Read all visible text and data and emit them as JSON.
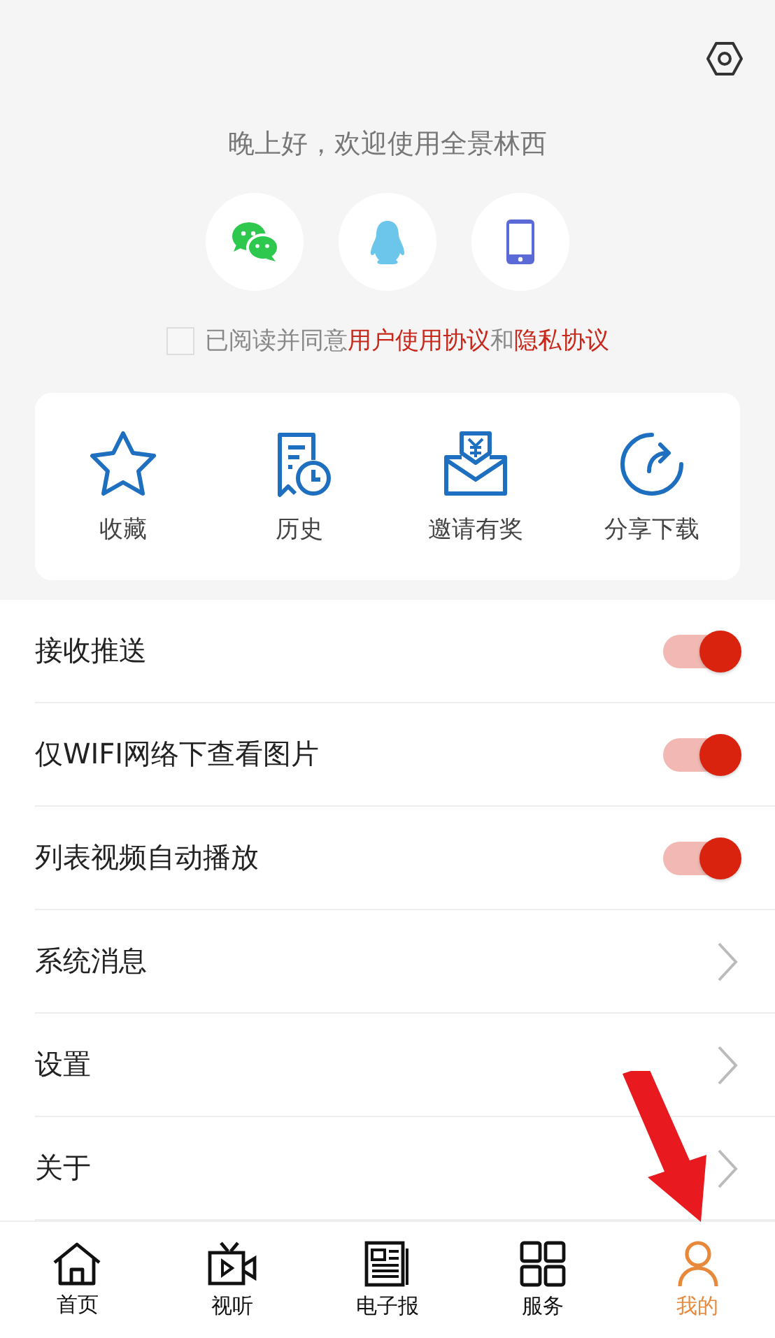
{
  "greeting": "晚上好，欢迎使用全景林西",
  "agreement": {
    "checked": false,
    "parts": [
      {
        "kind": "text",
        "text": "已阅读并同意"
      },
      {
        "kind": "link",
        "text": "用户使用协议"
      },
      {
        "kind": "text",
        "text": "和"
      },
      {
        "kind": "link",
        "text": "隐私协议"
      }
    ]
  },
  "quick_actions": [
    "收藏",
    "历史",
    "邀请有奖",
    "分享下载"
  ],
  "settings": [
    {
      "kind": "toggle",
      "label": "接收推送",
      "on": true
    },
    {
      "kind": "toggle",
      "label": "仅WIFI网络下查看图片",
      "on": true
    },
    {
      "kind": "toggle",
      "label": "列表视频自动播放",
      "on": true
    },
    {
      "kind": "link",
      "label": "系统消息"
    },
    {
      "kind": "link",
      "label": "设置"
    },
    {
      "kind": "link",
      "label": "关于"
    }
  ],
  "tabs": [
    {
      "label": "首页",
      "selected": false
    },
    {
      "label": "视听",
      "selected": false
    },
    {
      "label": "电子报",
      "selected": false
    },
    {
      "label": "服务",
      "selected": false
    },
    {
      "label": "我的",
      "selected": true
    }
  ]
}
